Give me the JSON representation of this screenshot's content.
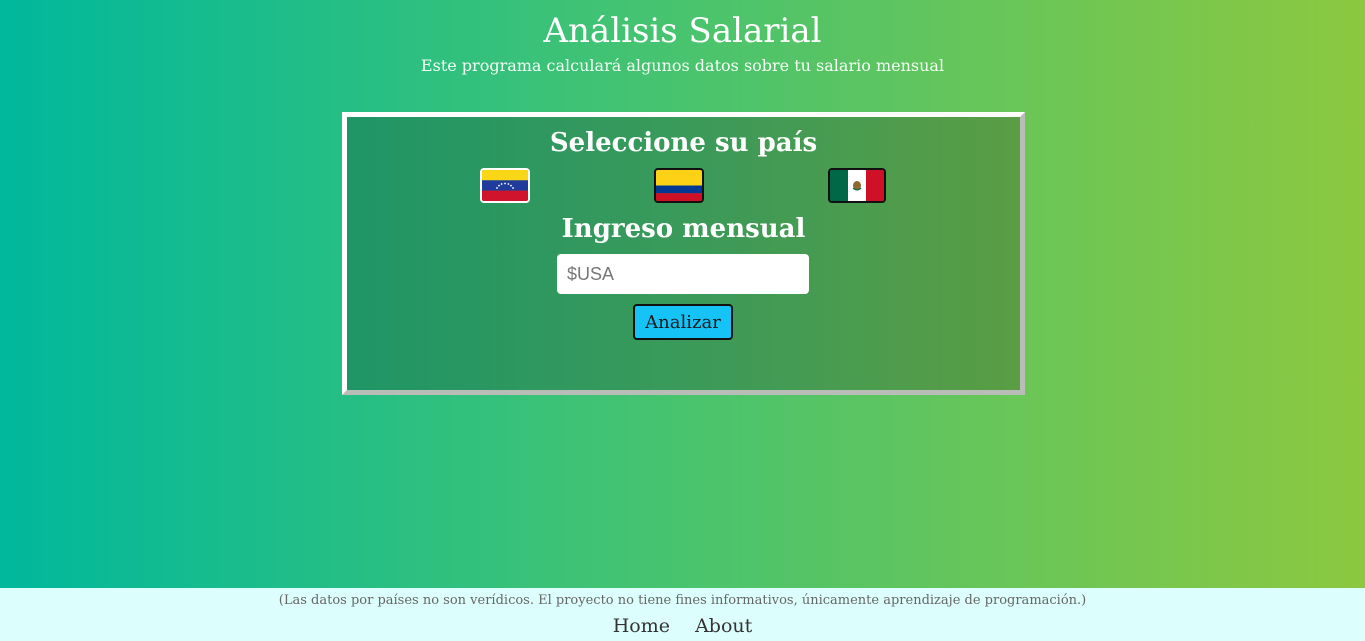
{
  "header": {
    "title": "Análisis Salarial",
    "subtitle": "Este programa calculará algunos datos sobre tu salario mensual"
  },
  "panel": {
    "country_heading": "Seleccione su país",
    "income_heading": "Ingreso mensual",
    "flags": [
      {
        "icon": "venezuela-flag-icon",
        "colors": [
          "#f9d616",
          "#1f3c9c",
          "#cf142b"
        ]
      },
      {
        "icon": "colombia-flag-icon",
        "colors": [
          "#fcd116",
          "#003893",
          "#ce1126"
        ]
      },
      {
        "icon": "mexico-flag-icon",
        "colors": [
          "#006847",
          "#ffffff",
          "#ce1126"
        ]
      }
    ],
    "income_input": {
      "placeholder": "$USA",
      "value": ""
    },
    "analyze_label": "Analizar"
  },
  "footer": {
    "disclaimer": "(Las datos por países no son verídicos. El proyecto no tiene fines informativos, únicamente aprendizaje de programación.)",
    "nav": [
      {
        "label": "Home"
      },
      {
        "label": "About"
      }
    ]
  },
  "colors": {
    "background_start": "#00b89c",
    "background_end": "#8cc840",
    "button": "#16c3f7",
    "footer": "#dcfffd"
  }
}
